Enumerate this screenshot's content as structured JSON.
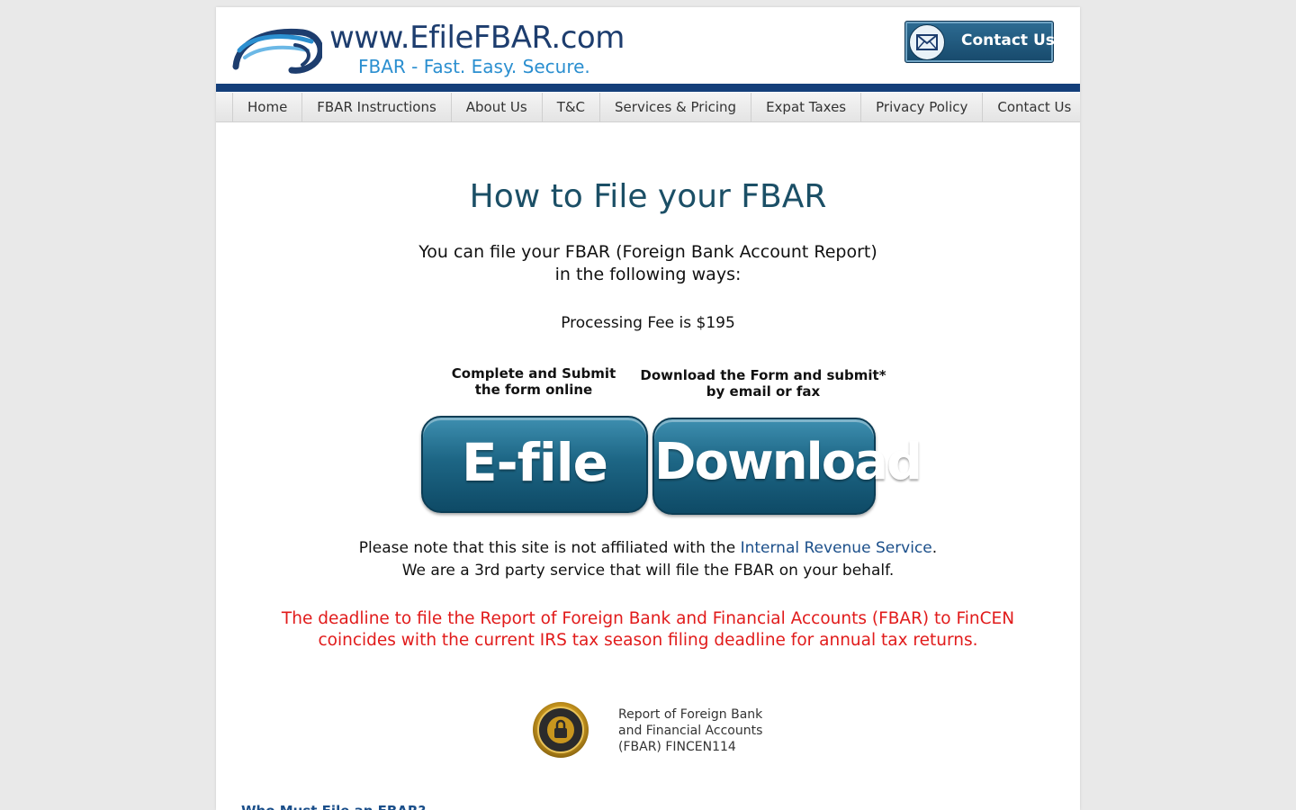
{
  "header": {
    "site_title": "www.EfileFBAR.com",
    "tagline": "FBAR - Fast. Easy. Secure.",
    "contact_button_label": "Contact Us"
  },
  "nav": {
    "items": [
      "Home",
      "FBAR Instructions",
      "About Us",
      "T&C",
      "Services & Pricing",
      "Expat Taxes",
      "Privacy Policy",
      "Contact Us"
    ]
  },
  "main": {
    "headline": "How to File your FBAR",
    "intro_line1": "You can file your FBAR (Foreign Bank Account Report)",
    "intro_line2": "in the following ways:",
    "fee": "Processing Fee is $195",
    "option1_caption_line1": "Complete and Submit",
    "option1_caption_line2": "the form online",
    "option1_button": "E-file",
    "option2_caption_line1": "Download the Form and submit*",
    "option2_caption_line2": "by email or fax",
    "option2_button": "Download",
    "note_prefix": "Please note that this site is not affiliated with the ",
    "note_link": "Internal Revenue Service",
    "note_suffix": ".",
    "note_line2": "We are a 3rd party service that will file the FBAR on your behalf.",
    "deadline_line1": "The deadline to file the Report of Foreign Bank and Financial Accounts (FBAR) to FinCEN",
    "deadline_line2": "coincides with the current IRS tax season filing deadline for annual tax returns.",
    "seal_text_line1": "Report of Foreign Bank",
    "seal_text_line2": "and Financial Accounts",
    "seal_text_line3": "(FBAR) FINCEN114",
    "bottom_link": "Who Must File an FBAR?"
  },
  "colors": {
    "brand_navy": "#1d3d6e",
    "tagline_blue": "#2b8fd0",
    "headline_teal": "#1b4f66",
    "deadline_red": "#e11b1b",
    "button_teal": "#1d6685"
  },
  "icons": {
    "logo": "swoosh-logo-icon",
    "contact": "envelope-icon",
    "seal": "secure-seal-icon"
  }
}
